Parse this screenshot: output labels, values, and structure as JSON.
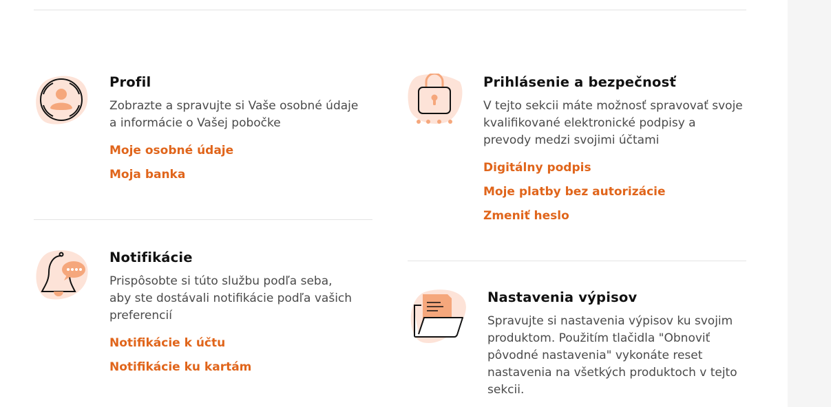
{
  "colors": {
    "accent": "#e0651b",
    "icon_blob": "#fde3d8",
    "icon_fill": "#f5a77c"
  },
  "sections": {
    "profile": {
      "icon": "user-avatar-icon",
      "title": "Profil",
      "description": "Zobrazte a spravujte si Vaše osobné údaje a informácie o Vašej pobočke",
      "links": [
        "Moje osobné údaje",
        "Moja banka"
      ]
    },
    "security": {
      "icon": "padlock-icon",
      "title": "Prihlásenie a bezpečnosť",
      "description": "V tejto sekcii máte možnosť spravovať svoje kvalifikované elektronické podpisy a prevody medzi svojimi účtami",
      "links": [
        "Digitálny podpis",
        "Moje platby bez autorizácie",
        "Zmeniť heslo"
      ]
    },
    "notifications": {
      "icon": "bell-icon",
      "title": "Notifikácie",
      "description": "Prispôsobte si túto službu podľa seba, aby ste dostávali notifikácie podľa vašich preferencií",
      "links": [
        "Notifikácie k účtu",
        "Notifikácie ku kartám"
      ]
    },
    "statements": {
      "icon": "folder-document-icon",
      "title": "Nastavenia výpisov",
      "description": "Spravujte si nastavenia výpisov ku svojim produktom. Použitím tlačidla \"Obnoviť pôvodné nastavenia\" vykonáte reset nastavenia na všetkých produktoch v tejto sekcii."
    }
  }
}
